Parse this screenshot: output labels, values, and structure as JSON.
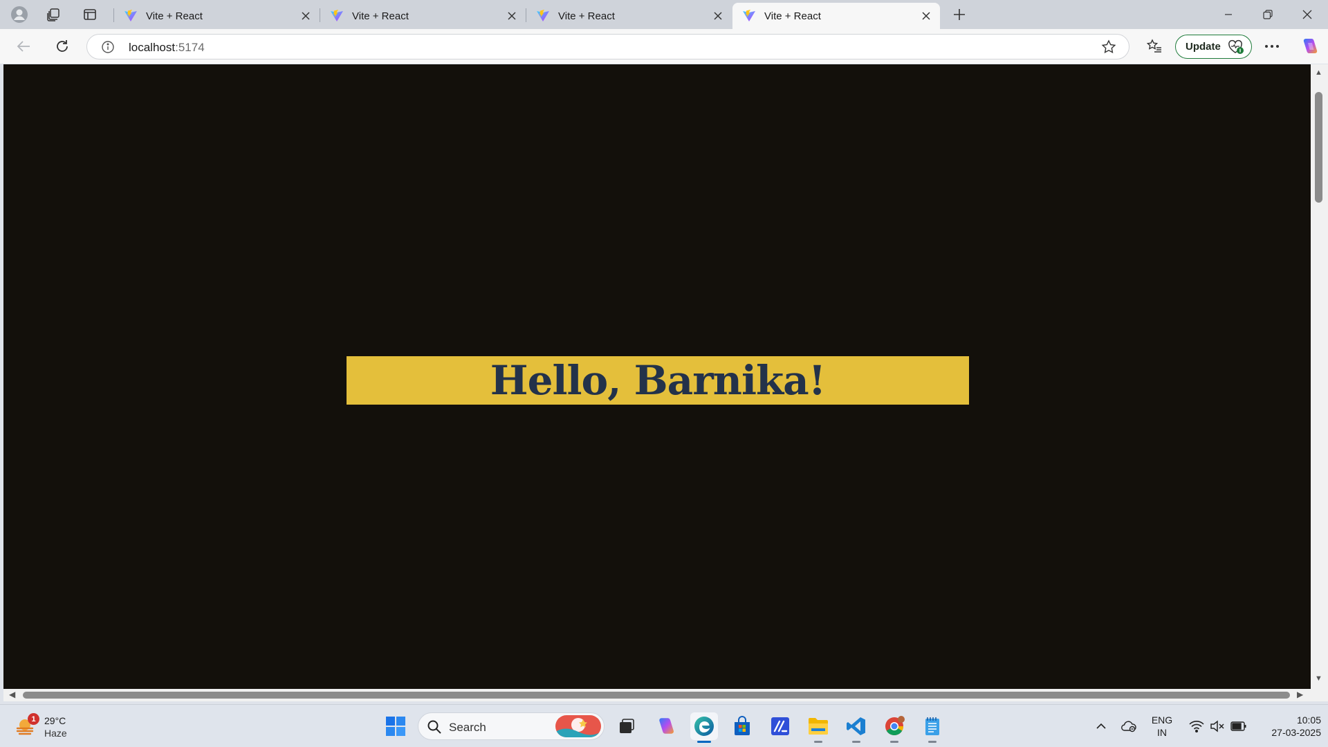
{
  "tabs": [
    {
      "title": "Vite + React",
      "active": false
    },
    {
      "title": "Vite + React",
      "active": false
    },
    {
      "title": "Vite + React",
      "active": false
    },
    {
      "title": "Vite + React",
      "active": true
    }
  ],
  "address_bar": {
    "host": "localhost",
    "port": ":5174"
  },
  "toolbar": {
    "update_label": "Update"
  },
  "page": {
    "heading": "Hello, Barnika!",
    "background_color": "#13100b",
    "banner_color": "#e4bf3b",
    "heading_color": "#23324a"
  },
  "taskbar": {
    "weather": {
      "temperature": "29°C",
      "condition": "Haze",
      "badge": "1"
    },
    "search_label": "Search",
    "pinned": [
      "task-view",
      "copilot",
      "edge",
      "microsoft-store",
      "vs-app",
      "file-explorer",
      "vscode",
      "chrome",
      "notepad"
    ],
    "language": {
      "line1": "ENG",
      "line2": "IN"
    },
    "clock": {
      "time": "10:05",
      "date": "27-03-2025"
    }
  }
}
